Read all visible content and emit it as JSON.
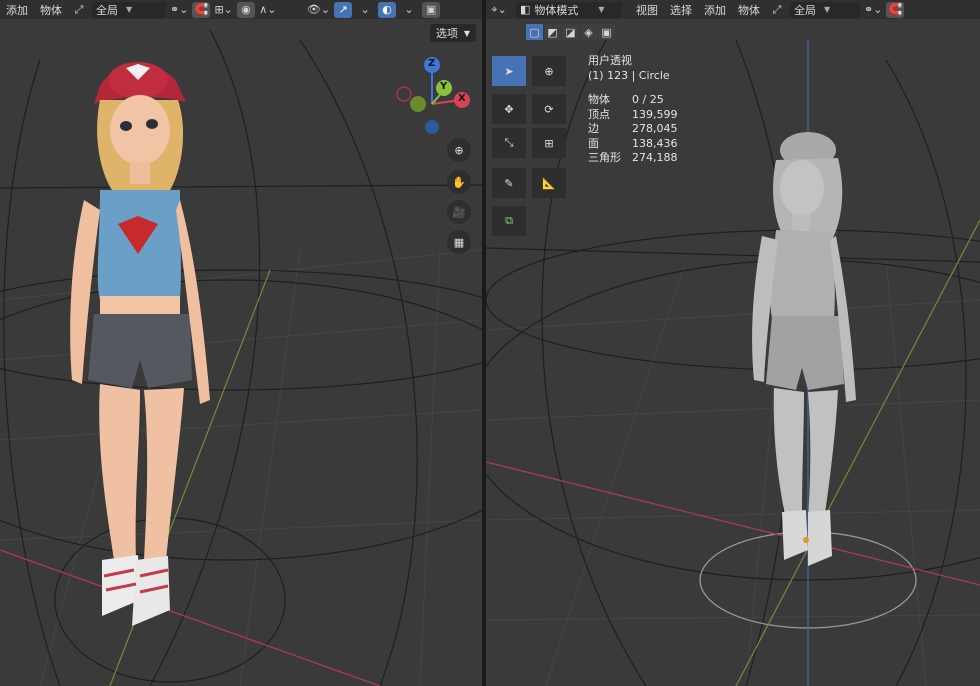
{
  "left_viewport": {
    "menu": [
      "添加",
      "物体"
    ],
    "transform_orientation": "全局",
    "options_label": "选项"
  },
  "right_viewport": {
    "editor_mode": "物体模式",
    "menu": [
      "视图",
      "选择",
      "添加",
      "物体"
    ],
    "transform_orientation": "全局",
    "view_name": "用户透视",
    "active_object": "(1) 123 | Circle",
    "stats": [
      {
        "label": "物体",
        "value": "0 / 25"
      },
      {
        "label": "顶点",
        "value": "139,599"
      },
      {
        "label": "边",
        "value": "278,045"
      },
      {
        "label": "面",
        "value": "138,436"
      },
      {
        "label": "三角形",
        "value": "274,188"
      }
    ]
  },
  "gizmo": {
    "x_label": "X",
    "y_label": "Y",
    "z_label": "Z"
  },
  "colors": {
    "header": "#303030",
    "viewport": "#3a3a3a",
    "accent": "#4772b3",
    "x_axis": "#d84357",
    "y_axis": "#8ac23a",
    "z_axis": "#3b79d8"
  },
  "icons": {
    "navigation": [
      "zoom-icon",
      "hand-pan-icon",
      "camera-icon",
      "grid-icon"
    ],
    "tools": [
      "select-cursor-icon",
      "3d-cursor-icon",
      "move-icon",
      "rotate-icon",
      "scale-icon",
      "transform-icon",
      "annotate-icon",
      "measure-icon",
      "add-cube-icon"
    ]
  }
}
